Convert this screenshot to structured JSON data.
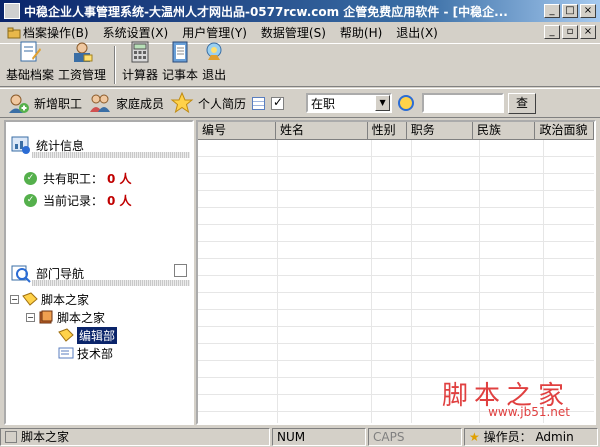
{
  "window": {
    "title": "中稳企业人事管理系统-大温州人才网出品-0577rcw.com 企管免费应用软件 - [中稳企..."
  },
  "menu": [
    {
      "label": "档案操作(B)",
      "icon": "folder-icon"
    },
    {
      "label": "系统设置(X)"
    },
    {
      "label": "用户管理(Y)"
    },
    {
      "label": "数据管理(S)"
    },
    {
      "label": "帮助(H)"
    },
    {
      "label": "退出(X)"
    }
  ],
  "toolbar": [
    {
      "label": "基础档案",
      "icon": "file-edit-icon"
    },
    {
      "label": "工资管理",
      "icon": "payroll-icon"
    },
    {
      "label": "计算器",
      "icon": "calculator-icon"
    },
    {
      "label": "记事本",
      "icon": "notebook-icon"
    },
    {
      "label": "退出",
      "icon": "exit-icon"
    }
  ],
  "actions": {
    "add_employee": "新增职工",
    "family": "家庭成员",
    "resume": "个人简历",
    "status_select": "在职",
    "search_placeholder": "",
    "search_button": "查"
  },
  "left": {
    "stats_title": "统计信息",
    "total_label": "共有职工：",
    "total_value": "0 人",
    "current_label": "当前记录：",
    "current_value": "0 人",
    "dept_title": "部门导航",
    "tree": {
      "root": "脚本之家",
      "child": "脚本之家",
      "items": [
        "编辑部",
        "技术部"
      ]
    }
  },
  "grid": {
    "columns": [
      "编号",
      "姓名",
      "性别",
      "职务",
      "民族",
      "政治面貌"
    ]
  },
  "watermark": {
    "text": "脚本之家",
    "url": "www.jb51.net"
  },
  "status": {
    "left": "脚本之家",
    "num": "NUM",
    "caps": "CAPS",
    "operator_label": "操作员：",
    "operator": "Admin"
  }
}
